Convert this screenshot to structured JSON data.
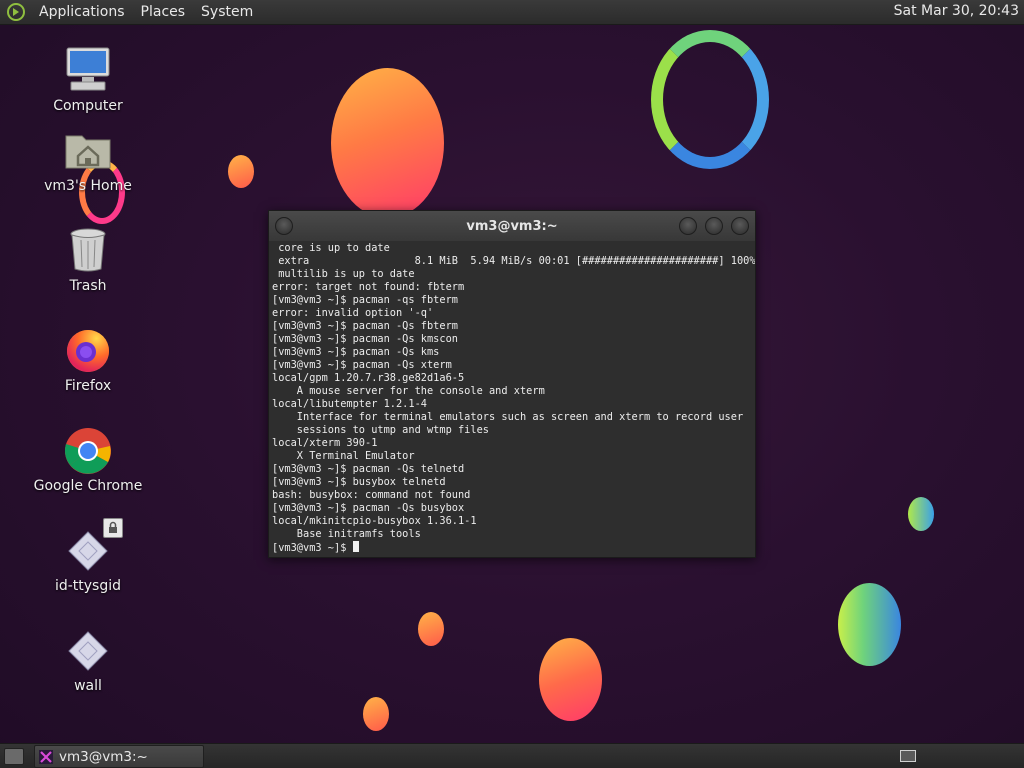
{
  "top_panel": {
    "menus": [
      "Applications",
      "Places",
      "System"
    ],
    "clock": "Sat Mar 30, 20:43"
  },
  "desktop": {
    "icons": [
      {
        "label": "Computer",
        "icon": "computer-icon"
      },
      {
        "label": "vm3's Home",
        "icon": "home-folder-icon"
      },
      {
        "label": "Trash",
        "icon": "trash-icon"
      },
      {
        "label": "Firefox",
        "icon": "firefox-icon"
      },
      {
        "label": "Google Chrome",
        "icon": "chrome-icon"
      },
      {
        "label": "id-ttysgid",
        "icon": "file-icon"
      },
      {
        "label": "wall",
        "icon": "file-icon"
      }
    ]
  },
  "terminal": {
    "title": "vm3@vm3:~",
    "lines": [
      " core is up to date",
      " extra                 8.1 MiB  5.94 MiB/s 00:01 [######################] 100%",
      " multilib is up to date",
      "error: target not found: fbterm",
      "[vm3@vm3 ~]$ pacman -qs fbterm",
      "error: invalid option '-q'",
      "[vm3@vm3 ~]$ pacman -Qs fbterm",
      "[vm3@vm3 ~]$ pacman -Qs kmscon",
      "[vm3@vm3 ~]$ pacman -Qs kms",
      "[vm3@vm3 ~]$ pacman -Qs xterm",
      "local/gpm 1.20.7.r38.ge82d1a6-5",
      "    A mouse server for the console and xterm",
      "local/libutempter 1.2.1-4",
      "    Interface for terminal emulators such as screen and xterm to record user",
      "    sessions to utmp and wtmp files",
      "local/xterm 390-1",
      "    X Terminal Emulator",
      "[vm3@vm3 ~]$ pacman -Qs telnetd",
      "[vm3@vm3 ~]$ busybox telnetd",
      "bash: busybox: command not found",
      "[vm3@vm3 ~]$ pacman -Qs busybox",
      "local/mkinitcpio-busybox 1.36.1-1",
      "    Base initramfs tools"
    ],
    "prompt": "[vm3@vm3 ~]$ "
  },
  "taskbar": {
    "task_label": "vm3@vm3:~"
  }
}
